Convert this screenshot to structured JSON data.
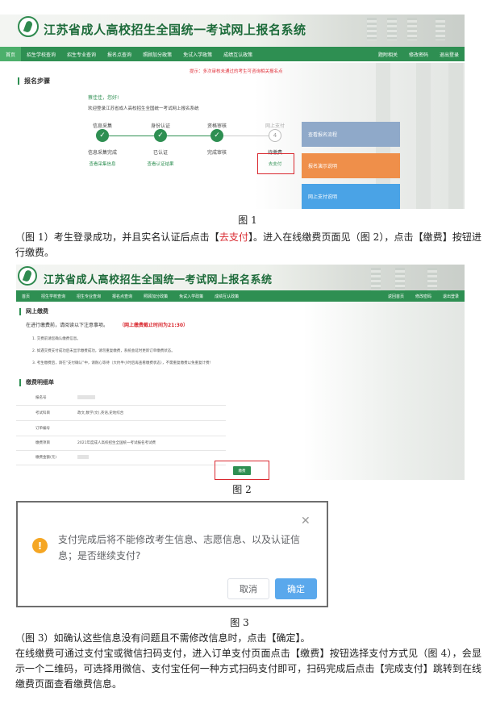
{
  "system_title": "江苏省成人高校招生全国统一考试网上报名系统",
  "fig1": {
    "nav": [
      "首页",
      "招生学校查询",
      "招生专业查询",
      "报名点查询",
      "照顾加分政策",
      "免试入学政策",
      "成绩互认政策"
    ],
    "nav_right": [
      "题附相关",
      "修改密码",
      "退出登录"
    ],
    "section_title": "报名步骤",
    "hint": "提示：多次审核未通过的考生可咨询相关报名点",
    "greeting": "蔡佳佳，您好!",
    "welcome": "欢迎登录江苏省成人高校招生全国统一考试网上报名系统",
    "steps": [
      {
        "title": "信息采集",
        "status": "信息采集完成",
        "link": "查看采集信息",
        "mark": "✓"
      },
      {
        "title": "身份认证",
        "status": "已认证",
        "link": "查看认证结果",
        "mark": "✓"
      },
      {
        "title": "资格审核",
        "status": "完成审核",
        "link": "",
        "mark": "✓"
      },
      {
        "title": "网上支付",
        "status": "待缴费",
        "link": "去支付",
        "mark": "4"
      }
    ],
    "side_buttons": [
      "查看报名流程",
      "报名演示说明",
      "网上支付说明"
    ],
    "caption": "图 1"
  },
  "para1": {
    "before": "（图 1）考生登录成功，并且实名认证后点击【",
    "red": "去支付",
    "middle": "】。进入在线缴费页面见（图 2），点击【缴费】按钮进行缴费。"
  },
  "fig2": {
    "nav": [
      "首页",
      "招生学校查询",
      "招生专业查询",
      "报名点查询",
      "照顾加分政策",
      "免试入学政策",
      "成绩互认政策"
    ],
    "nav_right": [
      "返回首页",
      "修改密码",
      "退出登录"
    ],
    "section_title": "网上缴费",
    "notice_lead": "在进行缴费前，请阅读以下注意事项。",
    "deadline": "（网上缴费截止时间为21:30）",
    "notes": [
      "1. 交费前请您确认缴费信息。",
      "2. 如遇交费支付成功后未显示缴费成功，请勿重复缴费，系统会延时更新订单缴费状态。",
      "3. 考生缴费后，请在“支付确认”中，请耐心等待（大约半小时后再查看缴费状态），不需重复缴费以免重复计费!"
    ],
    "detail_title": "缴费明细单",
    "fields": [
      {
        "label": "报名号",
        "value": ""
      },
      {
        "label": "考试科目",
        "value": "政文,数学(文),英语,史地综合"
      },
      {
        "label": "订单编号",
        "value": ""
      },
      {
        "label": "缴费项目",
        "value": "2021年度成人高校招生全国统一考试报名考试费"
      },
      {
        "label": "缴费金额(元)",
        "value": ""
      }
    ],
    "pay_button": "缴费",
    "caption": "图 2"
  },
  "fig3": {
    "message": "支付完成后将不能修改考生信息、志愿信息、以及认证信息；是否继续支付?",
    "cancel": "取消",
    "confirm": "确定",
    "caption": "图 3"
  },
  "para2": "（图 3）如确认这些信息没有问题且不需修改信息时，点击【确定】。",
  "para3": "在线缴费可通过支付宝或微信扫码支付，进入订单支付页面点击【缴费】按钮选择支付方式见（图 4），会显示一个二维码，可选择用微信、支付宝任何一种方式扫码支付即可，扫码完成后点击【完成支付】跳转到在线缴费页面查看缴费信息。"
}
